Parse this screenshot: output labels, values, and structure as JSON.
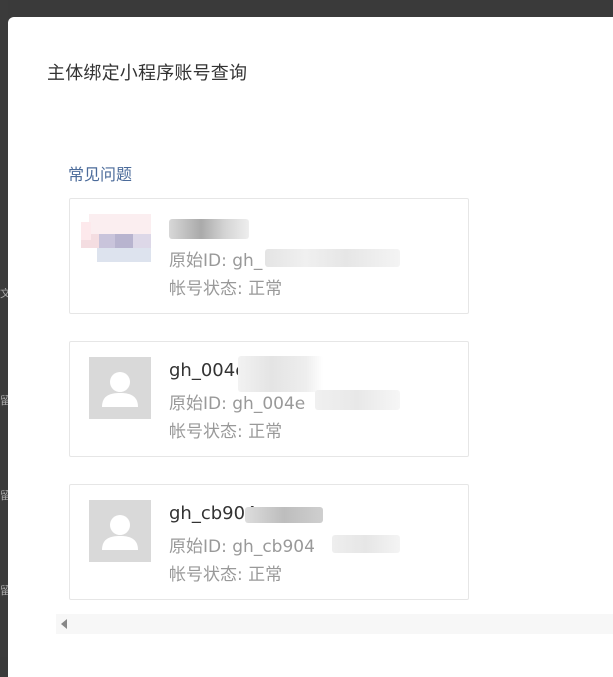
{
  "dialog": {
    "title": "主体绑定小程序账号查询",
    "faq_link": "常见问题"
  },
  "accounts": [
    {
      "name": "",
      "id_label": "原始ID:",
      "id_value": "gh_",
      "status_label": "帐号状态:",
      "status_value": "正常",
      "avatar": "mosaic-avatar"
    },
    {
      "name": "gh_004e",
      "id_label": "原始ID:",
      "id_value": "gh_004e",
      "status_label": "帐号状态:",
      "status_value": "正常",
      "avatar": "person-placeholder-icon"
    },
    {
      "name": "gh_cb904",
      "id_label": "原始ID:",
      "id_value": "gh_cb904",
      "status_label": "帐号状态:",
      "status_value": "正常",
      "avatar": "person-placeholder-icon"
    }
  ],
  "colors": {
    "faq_link": "#4b6b9a",
    "card_border": "#e6e6e6",
    "muted_text": "#999999"
  }
}
